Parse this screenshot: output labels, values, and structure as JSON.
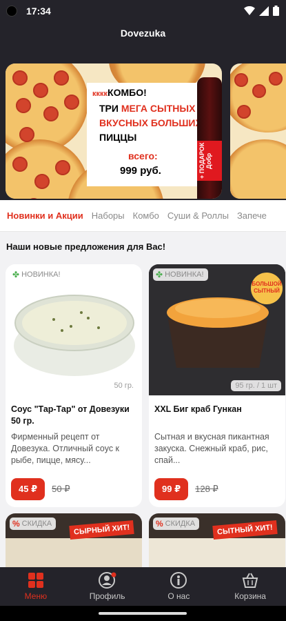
{
  "status_bar": {
    "time": "17:34"
  },
  "header": {
    "title": "Dovezuka"
  },
  "banner": {
    "line1_small": "кккк",
    "line1": "КОМБО!",
    "line2_a": "ТРИ ",
    "line2_b": "МЕГА СЫТНЫХ",
    "line3": "ВКУСНЫХ БОЛЬШИХ",
    "line4": "ПИЦЦЫ",
    "total_label": "всего:",
    "total_price": "999 руб.",
    "bottle_text": "+ ПОДАРОК  Добр"
  },
  "tabs": [
    {
      "label": "Новинки и Акции",
      "active": true
    },
    {
      "label": "Наборы"
    },
    {
      "label": "Комбо"
    },
    {
      "label": "Суши & Роллы"
    },
    {
      "label": "Запече"
    }
  ],
  "section_title": "Наши новые предложения для Вас!",
  "products": [
    {
      "badge": "НОВИНКА!",
      "weight": "50 гр.",
      "title": "Соус \"Тар-Тар\" от Довезуки 50 гр.",
      "description": "Фирменный рецепт от Довезука. Отличный соус к рыбе, пицце, мясу...",
      "price": "45 ₽",
      "old_price": "50 ₽"
    },
    {
      "badge": "НОВИНКА!",
      "weight": "95 гр. / 1 шт",
      "title": "XXL  Биг краб Гункан",
      "description": "Сытная и вкусная пикантная закуска. Снежный краб, рис, спай...",
      "price": "99 ₽",
      "old_price": "128 ₽",
      "sticker": "БОЛЬШОЙ СЫТНЫЙ"
    }
  ],
  "promo_cards": [
    {
      "badge": "СКИДКА",
      "sticker": "СЫРНЫЙ ХИТ!"
    },
    {
      "badge": "СКИДКА",
      "sticker": "СЫТНЫЙ ХИТ!"
    }
  ],
  "bottom_nav": [
    {
      "label": "Меню",
      "icon": "grid-icon",
      "active": true
    },
    {
      "label": "Профиль",
      "icon": "profile-icon"
    },
    {
      "label": "О нас",
      "icon": "info-icon"
    },
    {
      "label": "Корзина",
      "icon": "basket-icon"
    }
  ],
  "colors": {
    "accent": "#e0301e",
    "dark": "#24232a",
    "background": "#f2f2f4"
  }
}
